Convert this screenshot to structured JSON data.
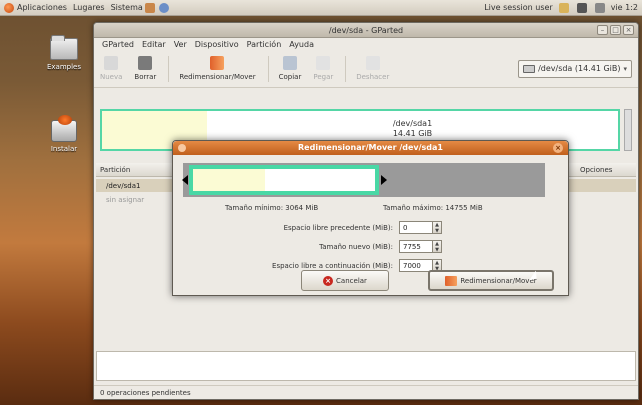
{
  "top_panel": {
    "menus": [
      "Aplicaciones",
      "Lugares",
      "Sistema"
    ],
    "session_label": "Live session user",
    "clock": "vie 1:2"
  },
  "desktop": {
    "icons": [
      {
        "label": "Examples",
        "icon": "folder-icon"
      },
      {
        "label": "Instalar",
        "icon": "installer-icon"
      }
    ]
  },
  "main_window": {
    "title": "/dev/sda - GParted",
    "controls": [
      "–",
      "□",
      "×"
    ],
    "menu": [
      "GParted",
      "Editar",
      "Ver",
      "Dispositivo",
      "Partición",
      "Ayuda"
    ],
    "toolbar": [
      {
        "label": "Nueva",
        "enabled": false,
        "icon": "new-icon"
      },
      {
        "label": "Borrar",
        "enabled": true,
        "icon": "trash-icon"
      },
      {
        "label": "Redimensionar/Mover",
        "enabled": true,
        "icon": "resize-icon"
      },
      {
        "label": "Copiar",
        "enabled": true,
        "icon": "copy-icon"
      },
      {
        "label": "Pegar",
        "enabled": false,
        "icon": "paste-icon"
      },
      {
        "label": "Deshacer",
        "enabled": false,
        "icon": "undo-icon"
      }
    ],
    "device_select": "/dev/sda  (14.41 GiB)",
    "partition_map": {
      "name": "/dev/sda1",
      "size": "14.41 GiB"
    },
    "table": {
      "headers": [
        "Partición",
        "Opciones"
      ],
      "rows": [
        {
          "label": "/dev/sda1",
          "selected": true
        },
        {
          "label": "sin asignar",
          "selected": false
        }
      ]
    },
    "status": "0 operaciones pendientes"
  },
  "dialog": {
    "title": "Redimensionar/Mover /dev/sda1",
    "min_size": "Tamaño mínimo: 3064 MiB",
    "max_size": "Tamaño máximo: 14755 MiB",
    "fields": [
      {
        "label": "Espacio libre precedente (MiB):",
        "value": "0"
      },
      {
        "label": "Tamaño nuevo (MiB):",
        "value": "7755"
      },
      {
        "label": "Espacio libre a continuación (MiB):",
        "value": "7000"
      }
    ],
    "cancel_label": "Cancelar",
    "resize_label": "Redimensionar/Mover"
  },
  "colors": {
    "accent_green": "#49d8a5",
    "title_orange": "#c05f1c",
    "used_space": "#fbfbd4"
  }
}
